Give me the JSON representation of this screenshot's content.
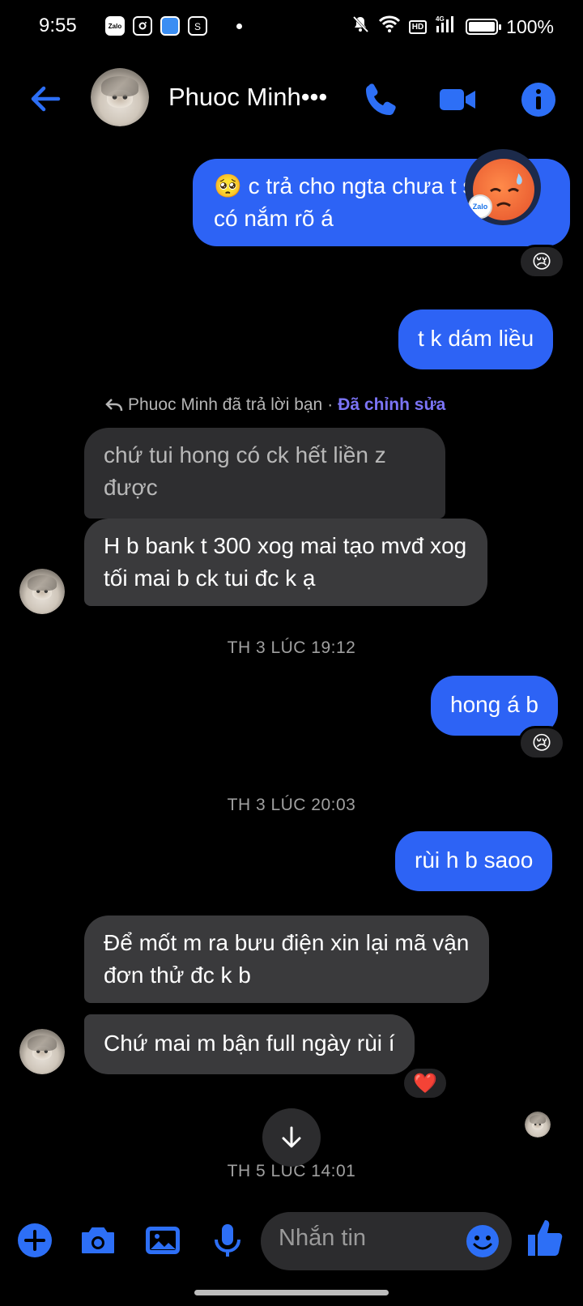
{
  "status_bar": {
    "time": "9:55",
    "zalo_label": "Zalo",
    "network": "4G",
    "hd": "HD",
    "battery": "100%",
    "battery_level": 1.0
  },
  "header": {
    "contact_name": "Phuoc Minh•••",
    "accent_color": "#2d6ff6"
  },
  "messages": {
    "m1_text": "c trả cho ngta chưa  t sao t k có nắm rõ á",
    "m1_emoji": "🥺",
    "m1_reaction": "😢",
    "m2_text": "t k dám liều",
    "reply_note": "Phuoc Minh đã trả lời bạn",
    "reply_sep": "·",
    "edited_label": "Đã chỉnh sửa",
    "m3_quoted": "chứ tui hong có ck hết liền z được",
    "m4_text": "H b bank t 300 xog mai tạo mvđ xog tối mai b ck tui đc k ạ",
    "ts1": "TH 3 LÚC 19:12",
    "m5_text": "hong á b",
    "m5_reaction": "😢",
    "ts2": "TH 3 LÚC 20:03",
    "m6_text": "rùi h b saoo",
    "m7_text": "Để mốt m ra bưu điện xin lại mã vận đơn thử đc k b",
    "m8_text": "Chứ mai m bận full ngày rùi í",
    "m8_reaction": "❤️",
    "ts3": "TH 5 LÚC 14:01"
  },
  "floating_bubble": {
    "badge": "Zalo"
  },
  "composer": {
    "placeholder": "Nhắn tin"
  }
}
